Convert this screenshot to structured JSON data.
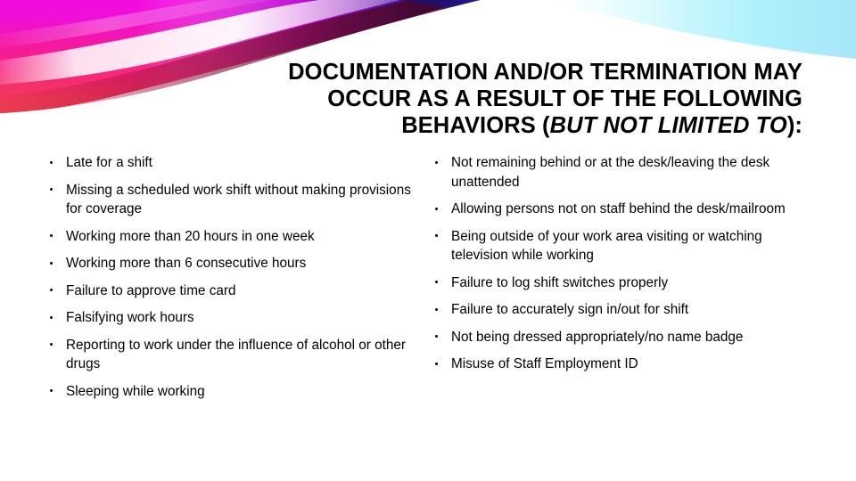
{
  "slide": {
    "background_color": "#ffffff",
    "title": {
      "lines": [
        "DOCUMENTATION AND/OR TERMINATION MAY",
        "OCCUR AS A RESULT OF THE FOLLOWING"
      ],
      "last_line_prefix": "BEHAVIORS (",
      "last_line_emphasis": "BUT NOT LIMITED TO",
      "last_line_suffix": "):",
      "color": "#000000",
      "align": "right"
    },
    "banner": {
      "name": "decorative-swoosh-banner",
      "colors": {
        "magenta": "#e612d8",
        "magenta_bright": "#f216e2",
        "pink": "#f5247f",
        "red_pink": "#ef3a52",
        "crimson": "#d41042",
        "dark_maroon": "#5d0a23",
        "violet": "#7b1ec8",
        "navy": "#14117a",
        "deep_navy": "#0b0a4a",
        "blue": "#1b5fd0",
        "cyan": "#17d6f2",
        "cyan_light": "#8ff0fb",
        "white": "#ffffff"
      }
    },
    "columns": {
      "left": {
        "name": "left-bullet-column",
        "items": [
          "Late for a shift",
          "Missing a scheduled work shift without making provisions for coverage",
          "Working more than 20 hours in one week",
          "Working more than 6 consecutive hours",
          "Failure to approve time card",
          "Falsifying work hours",
          "Reporting to work under the influence of alcohol or other drugs",
          "Sleeping while working"
        ]
      },
      "right": {
        "name": "right-bullet-column",
        "items": [
          "Not remaining behind or at the desk/leaving the desk unattended",
          "Allowing persons not on staff behind the desk/mailroom",
          "Being outside of your work area visiting or watching television while working",
          "Failure to log shift switches properly",
          "Failure to accurately sign in/out for shift",
          "Not being dressed appropriately/no name badge",
          "Misuse of Staff Employment ID"
        ]
      }
    }
  }
}
